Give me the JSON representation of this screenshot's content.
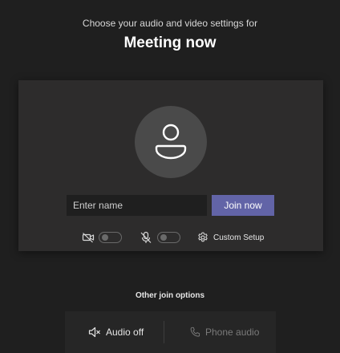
{
  "header": {
    "subtitle": "Choose your audio and video settings for",
    "title": "Meeting now"
  },
  "join_panel": {
    "name_placeholder": "Enter name",
    "name_value": "",
    "join_label": "Join now",
    "camera_toggle_on": false,
    "mic_toggle_on": false,
    "custom_setup_label": "Custom Setup"
  },
  "other_options": {
    "title": "Other join options",
    "audio_off_label": "Audio off",
    "phone_audio_label": "Phone audio"
  },
  "colors": {
    "background": "#1f1f1f",
    "panel": "#2d2c2c",
    "accent": "#6264a7",
    "disabled_text": "#7a7a7a"
  },
  "icons": {
    "avatar": "person-icon",
    "camera": "camera-off-icon",
    "mic": "mic-off-icon",
    "settings": "gear-icon",
    "audio_off": "speaker-off-icon",
    "phone": "phone-icon"
  }
}
